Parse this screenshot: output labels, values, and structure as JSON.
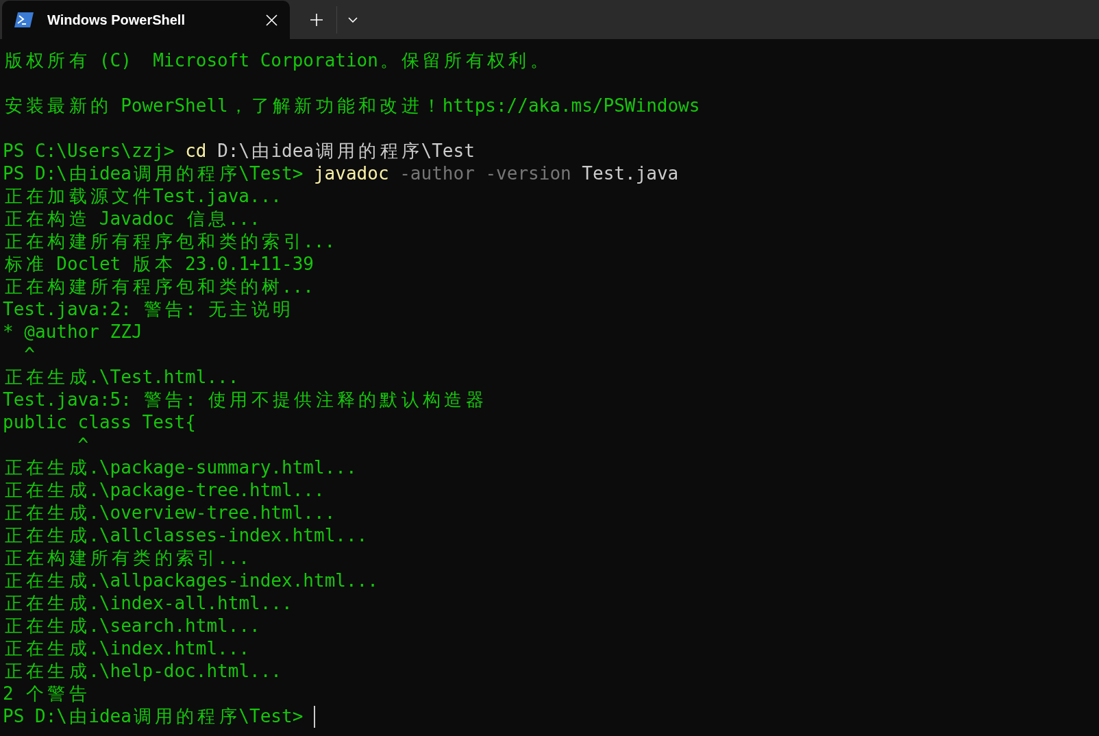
{
  "tab": {
    "title": "Windows PowerShell",
    "selected": true
  },
  "lines": [
    {
      "kind": "text",
      "segments": [
        {
          "kind": "output",
          "text": "版权所有 (C)  Microsoft Corporation。保留所有权利。"
        }
      ]
    },
    {
      "kind": "blank"
    },
    {
      "kind": "text",
      "segments": [
        {
          "kind": "output",
          "text": "安装最新的 PowerShell，了解新功能和改进！https://aka.ms/PSWindows"
        }
      ]
    },
    {
      "kind": "blank"
    },
    {
      "kind": "text",
      "segments": [
        {
          "kind": "prompt",
          "text": "PS C:\\Users\\zzj> "
        },
        {
          "kind": "command",
          "text": "cd"
        },
        {
          "kind": "argument",
          "text": " D:\\由idea调用的程序\\Test"
        }
      ]
    },
    {
      "kind": "text",
      "segments": [
        {
          "kind": "prompt",
          "text": "PS D:\\由idea调用的程序\\Test> "
        },
        {
          "kind": "command",
          "text": "javadoc"
        },
        {
          "kind": "option",
          "text": " -author -version"
        },
        {
          "kind": "argument",
          "text": " Test.java"
        }
      ]
    },
    {
      "kind": "text",
      "segments": [
        {
          "kind": "output",
          "text": "正在加载源文件Test.java..."
        }
      ]
    },
    {
      "kind": "text",
      "segments": [
        {
          "kind": "output",
          "text": "正在构造 Javadoc 信息..."
        }
      ]
    },
    {
      "kind": "text",
      "segments": [
        {
          "kind": "output",
          "text": "正在构建所有程序包和类的索引..."
        }
      ]
    },
    {
      "kind": "text",
      "segments": [
        {
          "kind": "output",
          "text": "标准 Doclet 版本 23.0.1+11-39"
        }
      ]
    },
    {
      "kind": "text",
      "segments": [
        {
          "kind": "output",
          "text": "正在构建所有程序包和类的树..."
        }
      ]
    },
    {
      "kind": "text",
      "segments": [
        {
          "kind": "output",
          "text": "Test.java:2: 警告: 无主说明"
        }
      ]
    },
    {
      "kind": "text",
      "segments": [
        {
          "kind": "output",
          "text": "* @author ZZJ"
        }
      ]
    },
    {
      "kind": "text",
      "segments": [
        {
          "kind": "output",
          "text": "  ^"
        }
      ]
    },
    {
      "kind": "text",
      "segments": [
        {
          "kind": "output",
          "text": "正在生成.\\Test.html..."
        }
      ]
    },
    {
      "kind": "text",
      "segments": [
        {
          "kind": "output",
          "text": "Test.java:5: 警告: 使用不提供注释的默认构造器"
        }
      ]
    },
    {
      "kind": "text",
      "segments": [
        {
          "kind": "output",
          "text": "public class Test{"
        }
      ]
    },
    {
      "kind": "text",
      "segments": [
        {
          "kind": "output",
          "text": "       ^"
        }
      ]
    },
    {
      "kind": "text",
      "segments": [
        {
          "kind": "output",
          "text": "正在生成.\\package-summary.html..."
        }
      ]
    },
    {
      "kind": "text",
      "segments": [
        {
          "kind": "output",
          "text": "正在生成.\\package-tree.html..."
        }
      ]
    },
    {
      "kind": "text",
      "segments": [
        {
          "kind": "output",
          "text": "正在生成.\\overview-tree.html..."
        }
      ]
    },
    {
      "kind": "text",
      "segments": [
        {
          "kind": "output",
          "text": "正在生成.\\allclasses-index.html..."
        }
      ]
    },
    {
      "kind": "text",
      "segments": [
        {
          "kind": "output",
          "text": "正在构建所有类的索引..."
        }
      ]
    },
    {
      "kind": "text",
      "segments": [
        {
          "kind": "output",
          "text": "正在生成.\\allpackages-index.html..."
        }
      ]
    },
    {
      "kind": "text",
      "segments": [
        {
          "kind": "output",
          "text": "正在生成.\\index-all.html..."
        }
      ]
    },
    {
      "kind": "text",
      "segments": [
        {
          "kind": "output",
          "text": "正在生成.\\search.html..."
        }
      ]
    },
    {
      "kind": "text",
      "segments": [
        {
          "kind": "output",
          "text": "正在生成.\\index.html..."
        }
      ]
    },
    {
      "kind": "text",
      "segments": [
        {
          "kind": "output",
          "text": "正在生成.\\help-doc.html..."
        }
      ]
    },
    {
      "kind": "text",
      "segments": [
        {
          "kind": "output",
          "text": "2 个警告"
        }
      ]
    },
    {
      "kind": "text",
      "cursor": true,
      "segments": [
        {
          "kind": "prompt",
          "text": "PS D:\\由idea调用的程序\\Test> "
        }
      ]
    }
  ]
}
